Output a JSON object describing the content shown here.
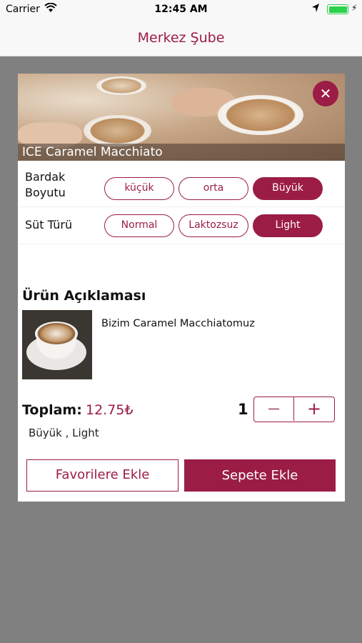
{
  "status_bar": {
    "carrier": "Carrier",
    "time": "12:45 AM"
  },
  "nav": {
    "title": "Merkez Şube"
  },
  "product": {
    "name": "ICE Caramel Macchiato"
  },
  "cup_size": {
    "label": "Bardak Boyutu",
    "options": [
      "küçük",
      "orta",
      "Büyük"
    ],
    "selected": "Büyük"
  },
  "milk_type": {
    "label": "Süt Türü",
    "options": [
      "Normal",
      "Laktozsuz",
      "Light"
    ],
    "selected": "Light"
  },
  "description": {
    "title": "Ürün Açıklaması",
    "text": "Bizim Caramel Macchiatomuz"
  },
  "total": {
    "label": "Toplam:",
    "price": "12.75₺",
    "quantity": "1"
  },
  "summary": "Büyük , Light",
  "actions": {
    "favorite_label": "Favorilere Ekle",
    "cart_label": "Sepete Ekle"
  },
  "colors": {
    "accent": "#9b1d45",
    "overlay": "#808080"
  },
  "icons": {
    "close": "close-icon",
    "minus": "minus-icon",
    "plus": "plus-icon",
    "wifi": "wifi-icon",
    "location": "location-icon",
    "battery": "battery-icon"
  }
}
